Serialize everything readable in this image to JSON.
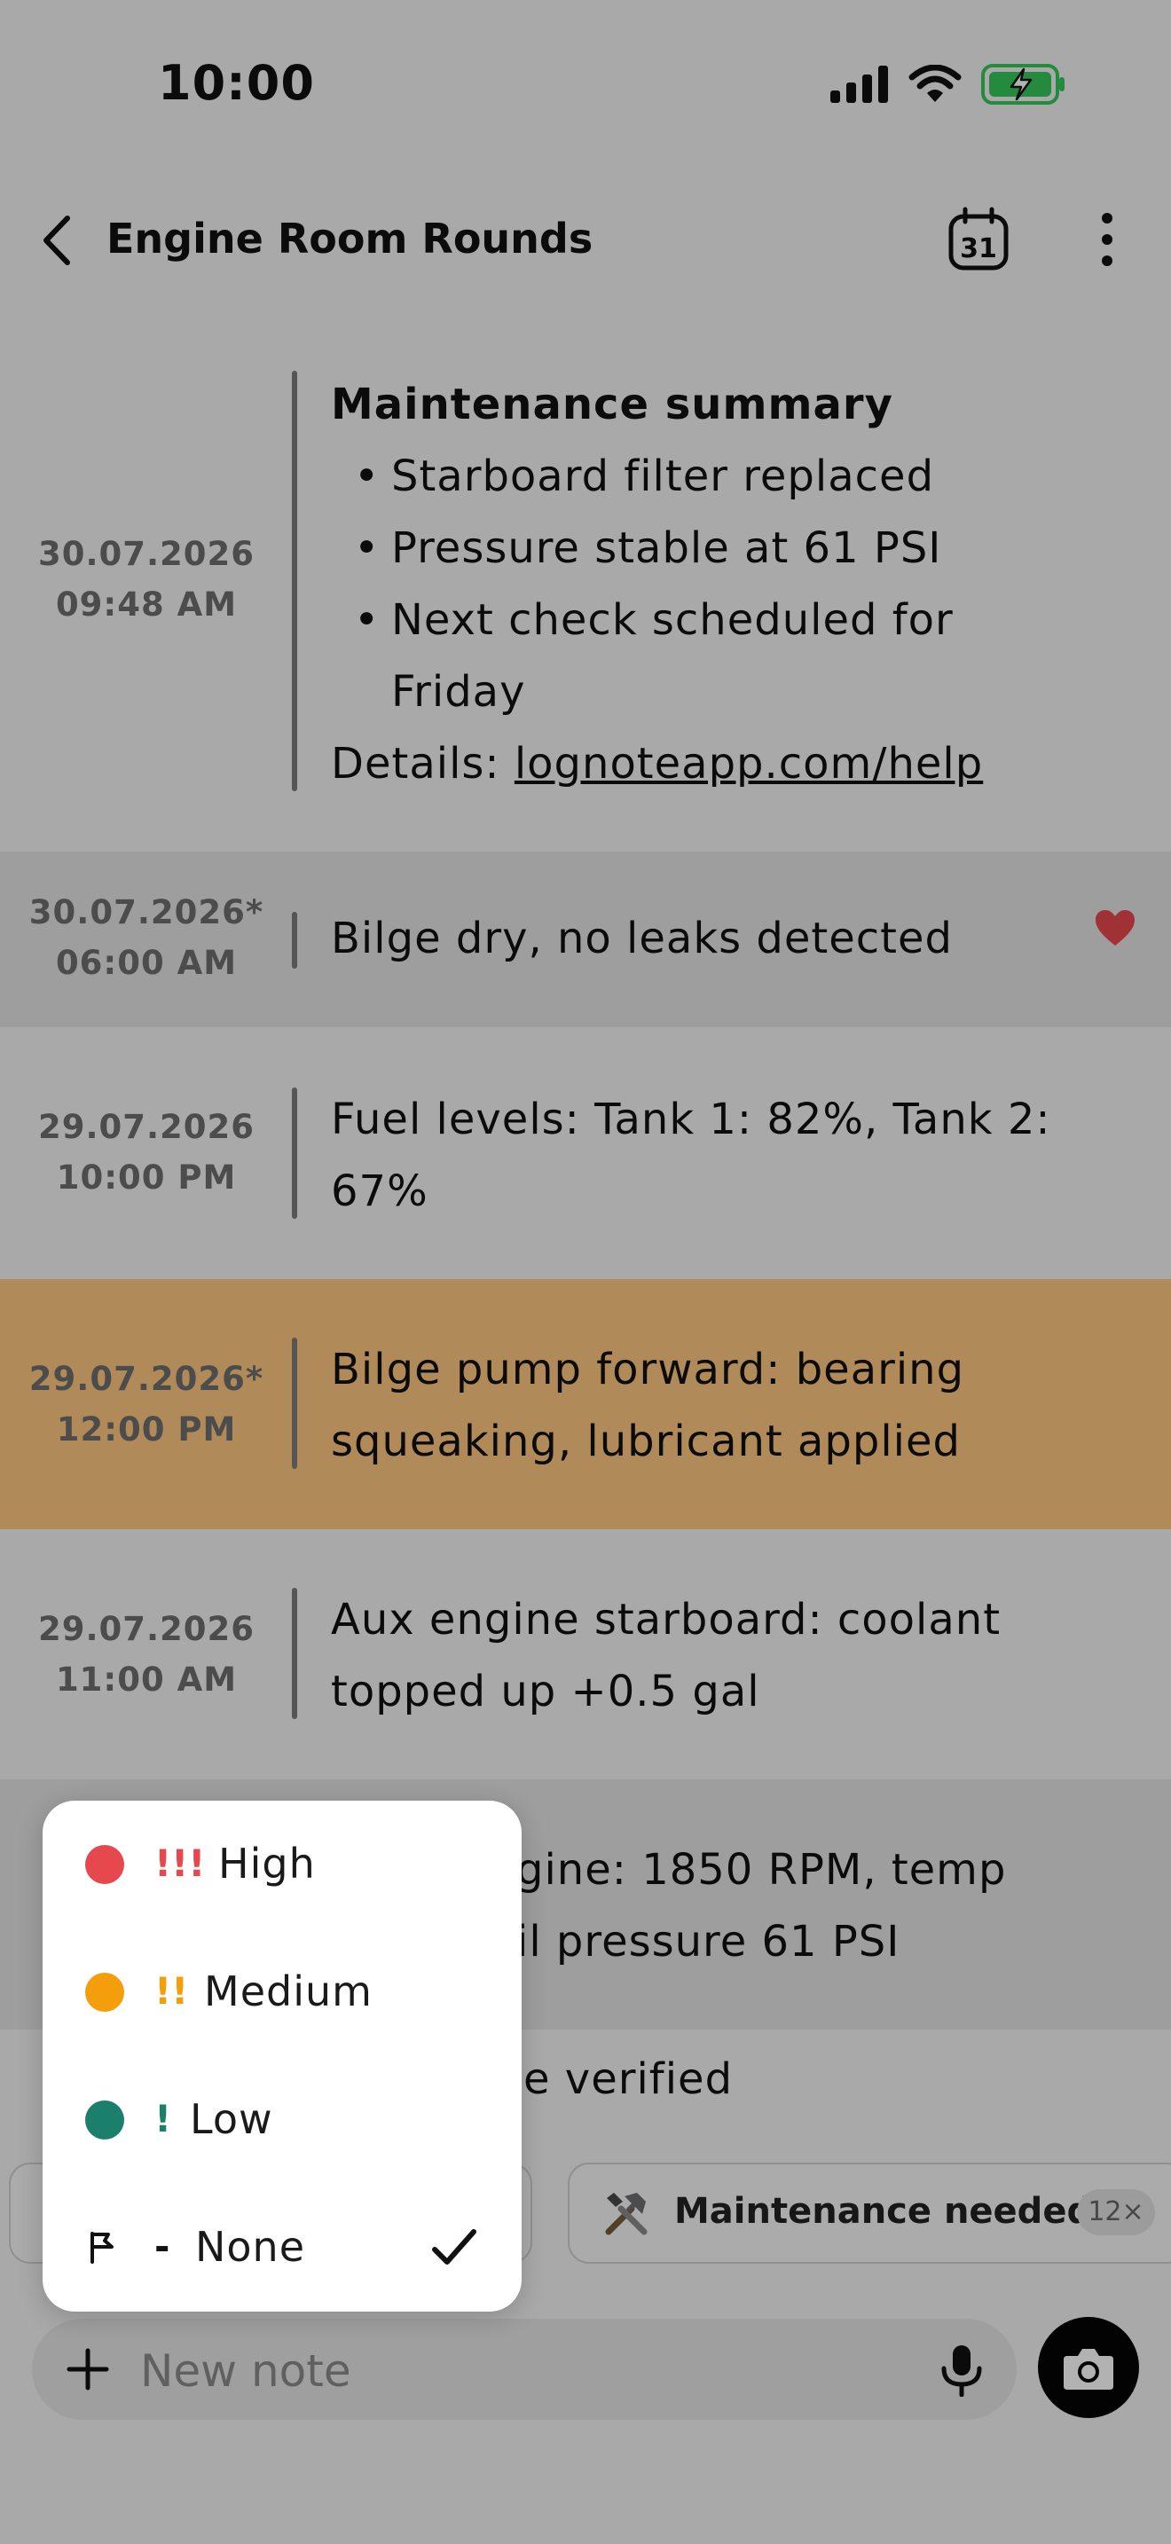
{
  "status_bar": {
    "time": "10:00"
  },
  "header": {
    "title": "Engine Room Rounds",
    "calendar_day": "31"
  },
  "entries": [
    {
      "date": "30.07.2026",
      "time": "09:48 AM",
      "heading": "Maintenance summary",
      "bullets": [
        "Starboard filter replaced",
        "Pressure stable at 61 PSI",
        "Next check scheduled for",
        "Friday"
      ],
      "details_prefix": "Details: ",
      "details_link": "lognoteapp.com/help"
    },
    {
      "date": "30.07.2026*",
      "time": "06:00 AM",
      "line1": "Bilge dry, no leaks detected"
    },
    {
      "date": "29.07.2026",
      "time": "10:00 PM",
      "line1": "Fuel levels: Tank 1: 82%, Tank 2:",
      "line2": "67%"
    },
    {
      "date": "29.07.2026*",
      "time": "12:00 PM",
      "line1": "Bilge pump forward: bearing",
      "line2": "squeaking, lubricant applied"
    },
    {
      "date": "29.07.2026",
      "time": "11:00 AM",
      "line1": "Aux engine starboard: coolant",
      "line2": "topped up +0.5 gal"
    },
    {
      "line1": "gine: 1850 RPM, temp",
      "line2": "il pressure 61 PSI"
    },
    {
      "line1": "e verified"
    }
  ],
  "chips": [
    {
      "label": "Maintenance needed",
      "count": "12×",
      "icon": "tools-icon"
    }
  ],
  "composer": {
    "placeholder": "New note"
  },
  "priority_menu": {
    "items": [
      {
        "marks": "!!!",
        "label": "High",
        "color": "#e5484d"
      },
      {
        "marks": "!!",
        "label": "Medium",
        "color": "#f59e0b"
      },
      {
        "marks": "!",
        "label": "Low",
        "color": "#1a7f6b"
      },
      {
        "marks": "-",
        "label": "None",
        "selected": true,
        "icon": "flag-icon"
      }
    ]
  },
  "colors": {
    "highlight_amber": "#fcc67e",
    "heart": "#e5484d",
    "battery": "#34c759"
  }
}
